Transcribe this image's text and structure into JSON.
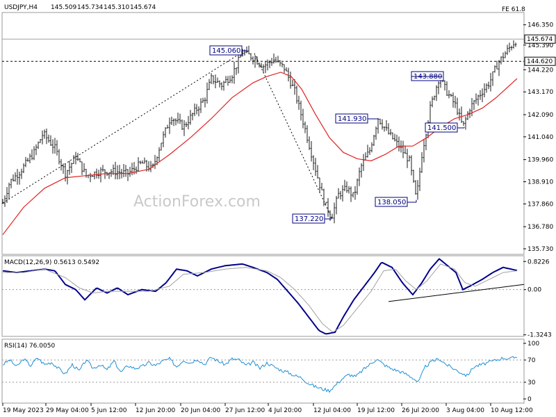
{
  "chart_data": [
    {
      "type": "ohlc",
      "header": {
        "symbol": "USDJPY,H4",
        "open": "145.509",
        "high": "145.734",
        "low": "145.310",
        "close": "145.674"
      },
      "fe_label": "FE 61.8",
      "watermark": "ActionForex.com",
      "y_ticks": [
        "146.350",
        "145.390",
        "144.220",
        "143.170",
        "142.090",
        "141.040",
        "139.960",
        "138.910",
        "137.860",
        "136.780",
        "135.730"
      ],
      "y_tick_values": [
        146.35,
        145.39,
        144.22,
        143.17,
        142.09,
        141.04,
        139.96,
        138.91,
        137.86,
        136.78,
        135.73
      ],
      "ylim": [
        135.5,
        146.9
      ],
      "price_tag": "145.674",
      "price_tag_value": 145.674,
      "level_tag": "144.620",
      "level_tag_value": 144.62,
      "fe_level_value": 145.674,
      "price_key": [
        [
          0,
          137.9
        ],
        [
          10,
          138.9
        ],
        [
          25,
          139.4
        ],
        [
          45,
          140.3
        ],
        [
          58,
          141.2
        ],
        [
          75,
          140.5
        ],
        [
          90,
          139.3
        ],
        [
          105,
          140.1
        ],
        [
          120,
          139.2
        ],
        [
          140,
          139.4
        ],
        [
          160,
          139.4
        ],
        [
          180,
          139.3
        ],
        [
          200,
          139.8
        ],
        [
          215,
          139.5
        ],
        [
          228,
          140.8
        ],
        [
          242,
          142.0
        ],
        [
          260,
          141.5
        ],
        [
          275,
          142.2
        ],
        [
          290,
          142.8
        ],
        [
          300,
          143.8
        ],
        [
          315,
          143.5
        ],
        [
          330,
          144.0
        ],
        [
          345,
          145.06
        ],
        [
          360,
          144.8
        ],
        [
          375,
          144.4
        ],
        [
          390,
          144.7
        ],
        [
          405,
          144.3
        ],
        [
          420,
          143.2
        ],
        [
          435,
          141.4
        ],
        [
          450,
          139.5
        ],
        [
          463,
          137.9
        ],
        [
          473,
          137.22
        ],
        [
          483,
          138.3
        ],
        [
          495,
          138.6
        ],
        [
          505,
          138.2
        ],
        [
          515,
          139.6
        ],
        [
          528,
          140.4
        ],
        [
          540,
          141.93
        ],
        [
          555,
          141.2
        ],
        [
          570,
          140.6
        ],
        [
          585,
          139.9
        ],
        [
          595,
          138.05
        ],
        [
          603,
          140.2
        ],
        [
          615,
          142.4
        ],
        [
          628,
          143.88
        ],
        [
          640,
          143.1
        ],
        [
          652,
          142.5
        ],
        [
          662,
          141.5
        ],
        [
          672,
          142.4
        ],
        [
          685,
          143.0
        ],
        [
          700,
          143.6
        ],
        [
          712,
          144.5
        ],
        [
          725,
          145.1
        ],
        [
          740,
          145.674
        ]
      ],
      "ma_key": [
        [
          0,
          136.4
        ],
        [
          30,
          137.7
        ],
        [
          60,
          138.6
        ],
        [
          90,
          139.1
        ],
        [
          120,
          139.2
        ],
        [
          150,
          139.3
        ],
        [
          180,
          139.3
        ],
        [
          210,
          139.5
        ],
        [
          240,
          140.2
        ],
        [
          270,
          141.0
        ],
        [
          300,
          141.9
        ],
        [
          330,
          142.9
        ],
        [
          360,
          143.6
        ],
        [
          380,
          143.9
        ],
        [
          400,
          144.1
        ],
        [
          415,
          143.9
        ],
        [
          430,
          143.3
        ],
        [
          450,
          142.1
        ],
        [
          470,
          141.0
        ],
        [
          490,
          140.3
        ],
        [
          510,
          140.0
        ],
        [
          530,
          139.9
        ],
        [
          550,
          140.2
        ],
        [
          570,
          140.6
        ],
        [
          590,
          140.6
        ],
        [
          610,
          141.0
        ],
        [
          630,
          141.5
        ],
        [
          650,
          141.9
        ],
        [
          670,
          142.1
        ],
        [
          690,
          142.4
        ],
        [
          710,
          142.9
        ],
        [
          740,
          143.8
        ]
      ],
      "annotations": [
        {
          "label": "145.060",
          "value": 145.06
        },
        {
          "label": "137.220",
          "value": 137.22
        },
        {
          "label": "141.930",
          "value": 141.93
        },
        {
          "label": "138.050",
          "value": 138.05
        },
        {
          "label": "143.880",
          "value": 143.88
        },
        {
          "label": "141.500",
          "value": 141.5
        }
      ],
      "x_labels": [
        "19 May 2023",
        "29 May 04:00",
        "5 Jun 12:00",
        "12 Jun 20:00",
        "20 Jun 04:00",
        "27 Jun 12:00",
        "4 Jul 20:00",
        "12 Jul 04:00",
        "19 Jul 12:00",
        "26 Jul 20:00",
        "3 Aug 04:00",
        "10 Aug 12:00"
      ]
    },
    {
      "type": "line",
      "title": "MACD(12,26,9) 0.5613 0.5492",
      "y_ticks": [
        "0.8226",
        "0.00",
        "-1.3243"
      ],
      "y_tick_values": [
        0.8226,
        0.0,
        -1.3243
      ],
      "ylim": [
        -1.35,
        0.95
      ],
      "series": [
        {
          "values": [
            [
              0,
              0.55
            ],
            [
              20,
              0.5
            ],
            [
              40,
              0.55
            ],
            [
              60,
              0.6
            ],
            [
              75,
              0.55
            ],
            [
              90,
              0.15
            ],
            [
              105,
              0.0
            ],
            [
              118,
              -0.3
            ],
            [
              135,
              0.05
            ],
            [
              150,
              -0.1
            ],
            [
              165,
              0.05
            ],
            [
              180,
              -0.15
            ],
            [
              200,
              0.0
            ],
            [
              220,
              -0.05
            ],
            [
              235,
              0.2
            ],
            [
              250,
              0.6
            ],
            [
              265,
              0.55
            ],
            [
              280,
              0.4
            ],
            [
              300,
              0.6
            ],
            [
              320,
              0.7
            ],
            [
              345,
              0.75
            ],
            [
              360,
              0.65
            ],
            [
              380,
              0.5
            ],
            [
              395,
              0.3
            ],
            [
              410,
              -0.05
            ],
            [
              425,
              -0.4
            ],
            [
              440,
              -0.8
            ],
            [
              455,
              -1.2
            ],
            [
              465,
              -1.3
            ],
            [
              478,
              -1.25
            ],
            [
              490,
              -0.8
            ],
            [
              505,
              -0.3
            ],
            [
              520,
              0.1
            ],
            [
              535,
              0.5
            ],
            [
              545,
              0.8
            ],
            [
              560,
              0.65
            ],
            [
              575,
              0.2
            ],
            [
              590,
              -0.15
            ],
            [
              603,
              0.2
            ],
            [
              615,
              0.6
            ],
            [
              628,
              0.9
            ],
            [
              640,
              0.7
            ],
            [
              652,
              0.5
            ],
            [
              662,
              0.0
            ],
            [
              672,
              0.1
            ],
            [
              690,
              0.3
            ],
            [
              705,
              0.5
            ],
            [
              720,
              0.65
            ],
            [
              740,
              0.56
            ]
          ]
        },
        {
          "values": [
            [
              0,
              0.5
            ],
            [
              30,
              0.5
            ],
            [
              60,
              0.6
            ],
            [
              90,
              0.35
            ],
            [
              110,
              0.05
            ],
            [
              130,
              -0.1
            ],
            [
              150,
              -0.05
            ],
            [
              180,
              -0.05
            ],
            [
              210,
              -0.05
            ],
            [
              240,
              0.1
            ],
            [
              260,
              0.45
            ],
            [
              290,
              0.5
            ],
            [
              320,
              0.6
            ],
            [
              350,
              0.65
            ],
            [
              380,
              0.55
            ],
            [
              400,
              0.35
            ],
            [
              420,
              0.0
            ],
            [
              440,
              -0.45
            ],
            [
              460,
              -1.0
            ],
            [
              475,
              -1.25
            ],
            [
              490,
              -1.05
            ],
            [
              510,
              -0.55
            ],
            [
              530,
              -0.05
            ],
            [
              548,
              0.55
            ],
            [
              565,
              0.6
            ],
            [
              580,
              0.25
            ],
            [
              595,
              0.0
            ],
            [
              610,
              0.25
            ],
            [
              630,
              0.75
            ],
            [
              650,
              0.6
            ],
            [
              665,
              0.2
            ],
            [
              680,
              0.1
            ],
            [
              700,
              0.3
            ],
            [
              720,
              0.5
            ],
            [
              740,
              0.55
            ]
          ]
        }
      ],
      "trendline": [
        [
          555,
          -0.35
        ],
        [
          750,
          0.15
        ]
      ]
    },
    {
      "type": "line",
      "title": "RSI(14) 76.0050",
      "y_ticks": [
        "100",
        "70",
        "30",
        "0"
      ],
      "y_tick_values": [
        100,
        70,
        30,
        0
      ],
      "ylim": [
        0,
        100
      ],
      "series": [
        {
          "values": [
            [
              0,
              62
            ],
            [
              10,
              70
            ],
            [
              20,
              58
            ],
            [
              30,
              72
            ],
            [
              40,
              60
            ],
            [
              50,
              74
            ],
            [
              60,
              62
            ],
            [
              70,
              66
            ],
            [
              80,
              55
            ],
            [
              90,
              45
            ],
            [
              100,
              62
            ],
            [
              110,
              50
            ],
            [
              120,
              70
            ],
            [
              130,
              55
            ],
            [
              140,
              62
            ],
            [
              150,
              52
            ],
            [
              160,
              68
            ],
            [
              170,
              48
            ],
            [
              180,
              60
            ],
            [
              190,
              55
            ],
            [
              200,
              58
            ],
            [
              210,
              65
            ],
            [
              220,
              60
            ],
            [
              230,
              68
            ],
            [
              240,
              72
            ],
            [
              250,
              58
            ],
            [
              260,
              70
            ],
            [
              270,
              65
            ],
            [
              280,
              72
            ],
            [
              290,
              62
            ],
            [
              300,
              75
            ],
            [
              310,
              68
            ],
            [
              320,
              62
            ],
            [
              330,
              72
            ],
            [
              340,
              70
            ],
            [
              350,
              60
            ],
            [
              360,
              66
            ],
            [
              370,
              55
            ],
            [
              380,
              65
            ],
            [
              390,
              58
            ],
            [
              400,
              52
            ],
            [
              410,
              48
            ],
            [
              420,
              42
            ],
            [
              430,
              38
            ],
            [
              440,
              28
            ],
            [
              450,
              22
            ],
            [
              460,
              18
            ],
            [
              470,
              15
            ],
            [
              478,
              24
            ],
            [
              488,
              36
            ],
            [
              498,
              44
            ],
            [
              508,
              40
            ],
            [
              518,
              52
            ],
            [
              528,
              62
            ],
            [
              538,
              72
            ],
            [
              548,
              62
            ],
            [
              558,
              55
            ],
            [
              570,
              50
            ],
            [
              580,
              45
            ],
            [
              590,
              38
            ],
            [
              598,
              30
            ],
            [
              608,
              58
            ],
            [
              618,
              68
            ],
            [
              628,
              72
            ],
            [
              638,
              62
            ],
            [
              648,
              55
            ],
            [
              658,
              48
            ],
            [
              668,
              42
            ],
            [
              678,
              58
            ],
            [
              690,
              62
            ],
            [
              700,
              66
            ],
            [
              710,
              70
            ],
            [
              720,
              74
            ],
            [
              730,
              72
            ],
            [
              740,
              76
            ]
          ]
        }
      ]
    }
  ]
}
